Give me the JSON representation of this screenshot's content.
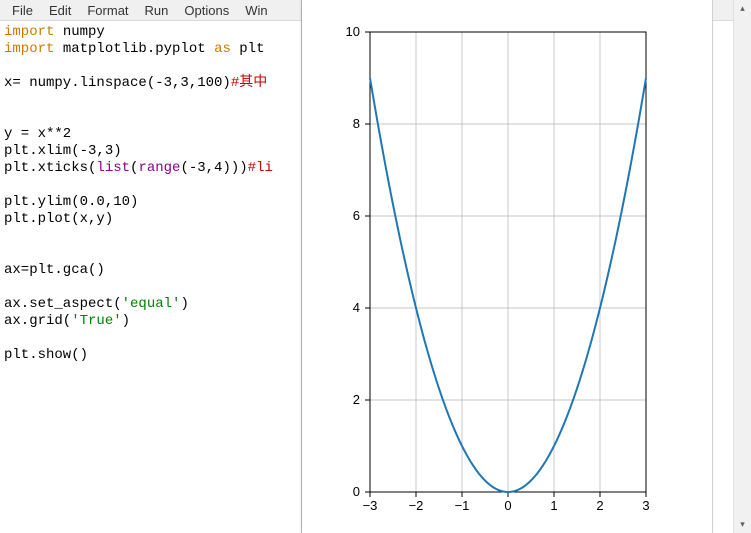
{
  "menubar": {
    "items": [
      "File",
      "Edit",
      "Format",
      "Run",
      "Options",
      "Win"
    ]
  },
  "code": {
    "tokens": [
      {
        "t": "import",
        "c": "kw"
      },
      {
        "t": " numpy\n"
      },
      {
        "t": "import",
        "c": "kw"
      },
      {
        "t": " matplotlib.pyplot "
      },
      {
        "t": "as",
        "c": "kw"
      },
      {
        "t": " plt\n"
      },
      {
        "t": "\n"
      },
      {
        "t": "x= numpy.linspace(-3,3,100)"
      },
      {
        "t": "#其中",
        "c": "cm"
      },
      {
        "t": "\n"
      },
      {
        "t": "\n"
      },
      {
        "t": "\n"
      },
      {
        "t": "y = x**2\n"
      },
      {
        "t": "plt.xlim(-3,3)\n"
      },
      {
        "t": "plt.xticks("
      },
      {
        "t": "list",
        "c": "bi"
      },
      {
        "t": "("
      },
      {
        "t": "range",
        "c": "bi"
      },
      {
        "t": "(-3,4)))"
      },
      {
        "t": "#li",
        "c": "cm"
      },
      {
        "t": "\n"
      },
      {
        "t": "\n"
      },
      {
        "t": "plt.ylim(0.0,10)\n"
      },
      {
        "t": "plt.plot(x,y)\n"
      },
      {
        "t": "\n"
      },
      {
        "t": "\n"
      },
      {
        "t": "ax=plt.gca()\n"
      },
      {
        "t": "\n"
      },
      {
        "t": "ax.set_aspect("
      },
      {
        "t": "'equal'",
        "c": "str"
      },
      {
        "t": ")\n"
      },
      {
        "t": "ax.grid("
      },
      {
        "t": "'True'",
        "c": "str"
      },
      {
        "t": ")\n"
      },
      {
        "t": "\n"
      },
      {
        "t": "plt.show()\n"
      }
    ]
  },
  "chart_data": {
    "type": "line",
    "x": [
      -3,
      -2.5,
      -2,
      -1.5,
      -1,
      -0.5,
      0,
      0.5,
      1,
      1.5,
      2,
      2.5,
      3
    ],
    "values": [
      9,
      6.25,
      4,
      2.25,
      1,
      0.25,
      0,
      0.25,
      1,
      2.25,
      4,
      6.25,
      9
    ],
    "xlabel": "",
    "ylabel": "",
    "xlim": [
      -3,
      3
    ],
    "ylim": [
      0,
      10
    ],
    "xticks": [
      -3,
      -2,
      -1,
      0,
      1,
      2,
      3
    ],
    "yticks": [
      0,
      2,
      4,
      6,
      8,
      10
    ],
    "grid": true,
    "aspect": "equal",
    "curve_color": "#1f77b4"
  },
  "scrollbar": {
    "up": "▴",
    "down": "▾"
  }
}
